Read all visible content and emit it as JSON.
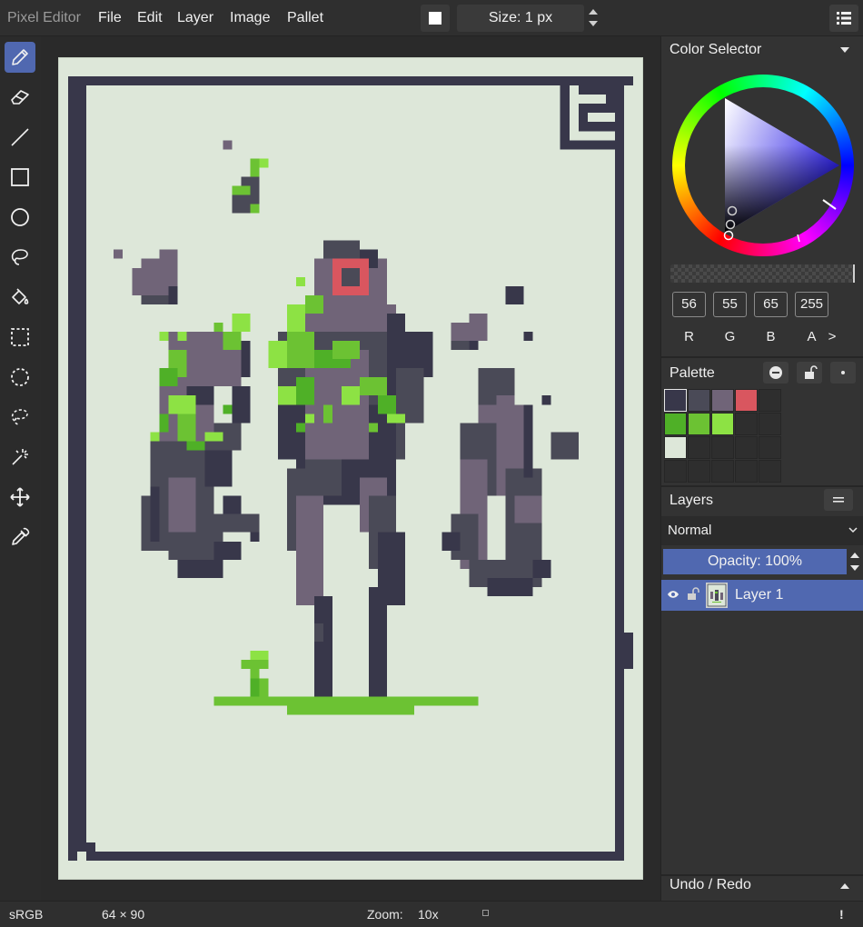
{
  "app": {
    "title": "Pixel Editor"
  },
  "menu": [
    "File",
    "Edit",
    "Layer",
    "Image",
    "Pallet"
  ],
  "toolbar_top": {
    "size_label": "Size: 1 px",
    "brush_color": "#ffffff"
  },
  "tools": [
    {
      "name": "pencil-tool",
      "icon": "pencil-icon",
      "active": true
    },
    {
      "name": "eraser-tool",
      "icon": "eraser-icon"
    },
    {
      "name": "line-tool",
      "icon": "line-icon"
    },
    {
      "name": "rectangle-tool",
      "icon": "rectangle-icon"
    },
    {
      "name": "ellipse-tool",
      "icon": "ellipse-icon"
    },
    {
      "name": "lasso-tool",
      "icon": "lasso-icon"
    },
    {
      "name": "fill-tool",
      "icon": "paint-bucket-icon"
    },
    {
      "name": "rect-select-tool",
      "icon": "rect-select-icon"
    },
    {
      "name": "ellipse-select-tool",
      "icon": "ellipse-select-icon"
    },
    {
      "name": "lasso-select-tool",
      "icon": "lasso-select-icon"
    },
    {
      "name": "magic-wand-tool",
      "icon": "magic-wand-icon"
    },
    {
      "name": "move-tool",
      "icon": "move-icon"
    },
    {
      "name": "eyedropper-tool",
      "icon": "eyedropper-icon"
    }
  ],
  "color_selector": {
    "title": "Color Selector",
    "channels": [
      {
        "label": "R",
        "value": "56"
      },
      {
        "label": "G",
        "value": "55"
      },
      {
        "label": "B",
        "value": "65"
      },
      {
        "label": "A",
        "value": "255"
      }
    ],
    "more_label": ">"
  },
  "palette": {
    "title": "Palette",
    "colors": [
      "#38374a",
      "#4a4a57",
      "#706478",
      "#d9565f",
      "",
      "#4fb027",
      "#6cc233",
      "#8de244",
      "",
      "",
      "#dde7d9",
      "",
      "",
      "",
      "",
      "",
      "",
      "",
      "",
      ""
    ],
    "selected": 0
  },
  "layers": {
    "title": "Layers",
    "blend_mode": "Normal",
    "opacity_label": "Opacity: 100%",
    "items": [
      {
        "name": "Layer 1"
      }
    ]
  },
  "undo_redo": {
    "title": "Undo / Redo"
  },
  "status": {
    "color_space": "sRGB",
    "dimensions": "64 × 90",
    "zoom_label": "Zoom:",
    "zoom_value": "10x",
    "alert": "!"
  },
  "colors": {
    "accent": "#5068b0",
    "canvas_bg": "#dde7d9",
    "pixel_dark": "#38374a",
    "pixel_mid": "#4a4a57",
    "pixel_light": "#706478",
    "pixel_green_dark": "#4fb027",
    "pixel_green": "#6cc233",
    "pixel_green_light": "#8de244",
    "pixel_red": "#d9565f",
    "current_color": "#383741"
  }
}
